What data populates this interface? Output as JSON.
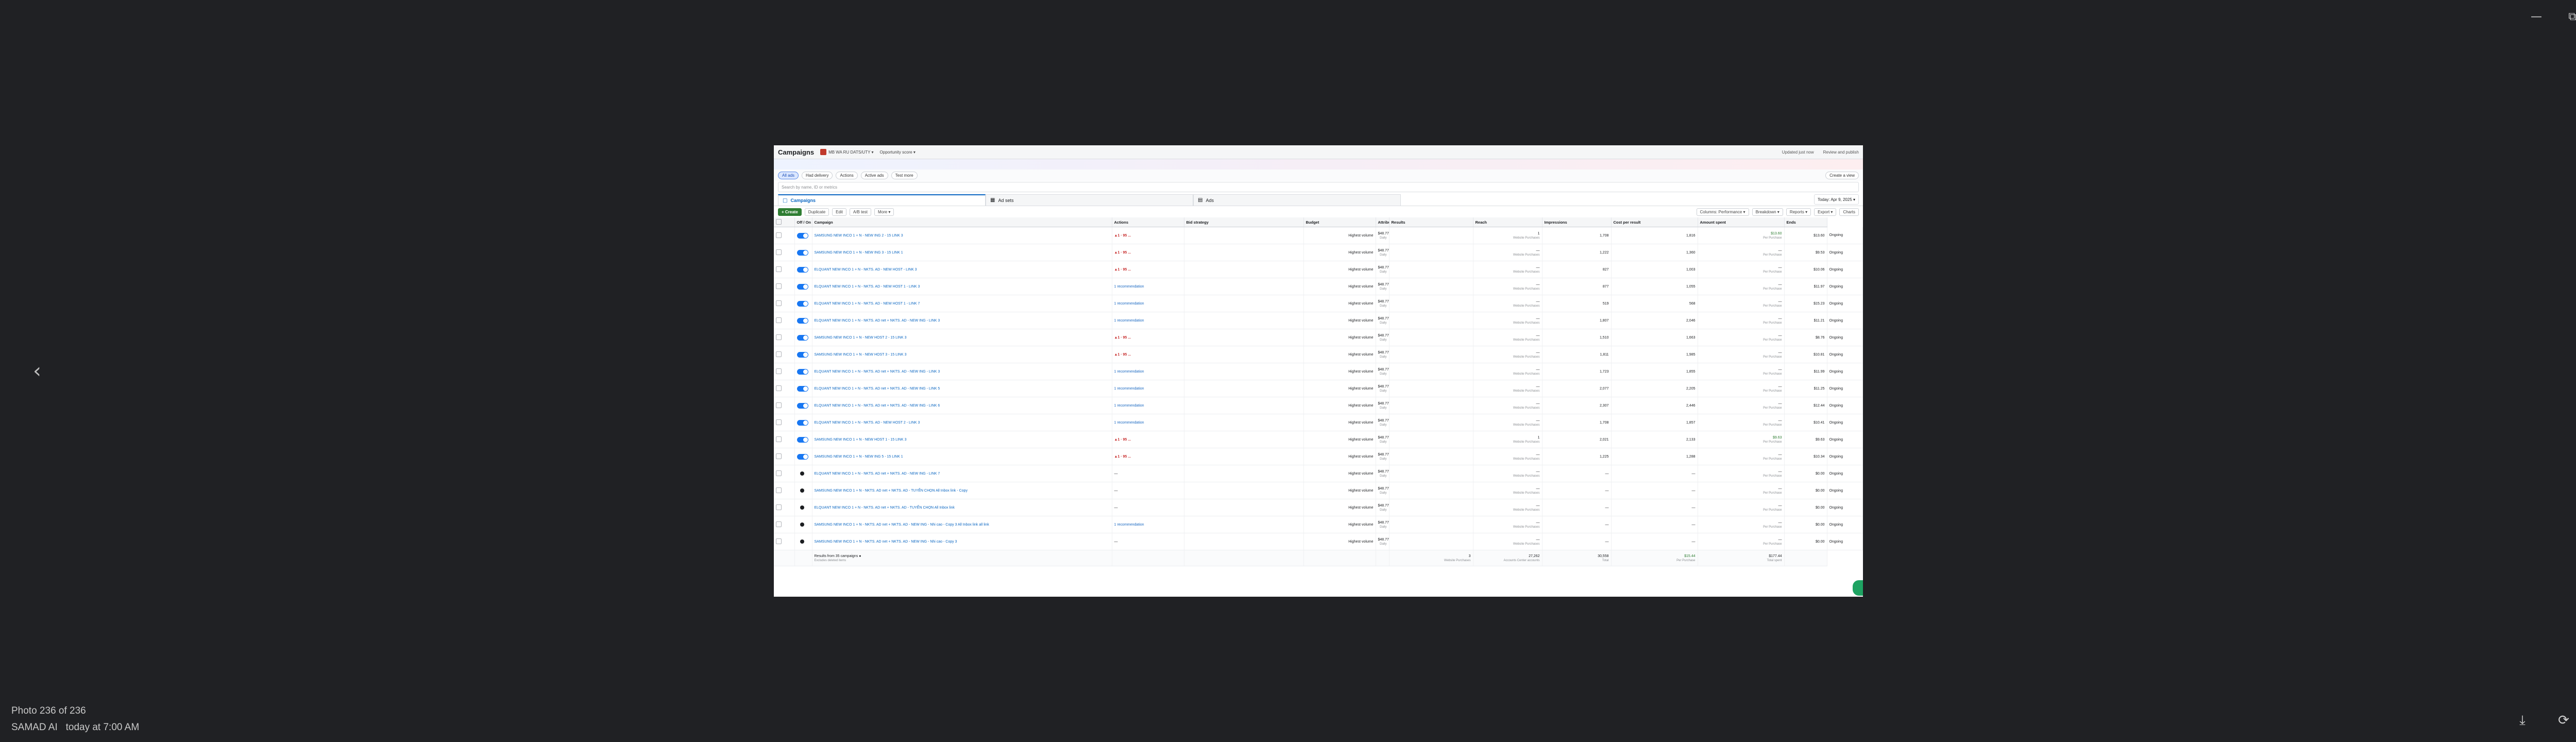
{
  "viewer": {
    "photo_count": "Photo 236 of 236",
    "author": "SAMAD AI",
    "time": "today at 7:00 AM",
    "icons": [
      "minimize-icon",
      "maximize-icon",
      "close-icon",
      "chevron-left-icon",
      "download-icon",
      "rotate-icon",
      "more-icon"
    ]
  },
  "header": {
    "title": "Campaigns",
    "account": "MB WA RU DATS/UTY ▾",
    "opportunity": "Opportunity score ▾",
    "updated": "Updated just now",
    "review": "Review and publish"
  },
  "filters": [
    "All ads",
    "Had delivery",
    "Actions",
    "Active ads",
    "Test more"
  ],
  "create_view": "Create a view",
  "search_placeholder": "Search by name, ID or metrics",
  "levels": [
    {
      "label": "Campaigns",
      "icon": "folder-icon",
      "active": true
    },
    {
      "label": "Ad sets",
      "icon": "grid-icon",
      "active": false
    },
    {
      "label": "Ads",
      "icon": "doc-icon",
      "active": false
    }
  ],
  "date_range": "Today: Apr 9, 2025 ▾",
  "toolbar": {
    "create": "+ Create",
    "duplicate": "Duplicate",
    "edit": "Edit",
    "ab_test": "A/B test",
    "more": "More ▾",
    "columns": "Columns: Performance ▾",
    "breakdown": "Breakdown ▾",
    "reports": "Reports ▾",
    "export": "Export ▾",
    "charts": "Charts"
  },
  "columns": [
    "Off / On",
    "Campaign",
    "Actions",
    "Bid strategy",
    "Budget",
    "Attribution setting",
    "Results",
    "Reach",
    "Impressions",
    "Cost per result",
    "Amount spent",
    "Ends"
  ],
  "rows": [
    {
      "on": true,
      "name": "SAMSUNG NEW INCO 1 + N - NEW ING 2 - 15 LINK 3",
      "action": "▲1 · 95 ...",
      "kind": "issue",
      "bid": "Highest volume",
      "budget": "$48.77 0847",
      "results": "1",
      "reach": "1,708",
      "impr": "1,816",
      "cpr": "$13.60",
      "spent": "$13.60",
      "ends": "Ongoing"
    },
    {
      "on": true,
      "name": "SAMSUNG NEW INCO 1 + N - NEW ING 3 - 15 LINK 1",
      "action": "▲1 · 95 ...",
      "kind": "issue",
      "bid": "Highest volume",
      "budget": "$48.77 0847",
      "results": "—",
      "reach": "1,222",
      "impr": "1,360",
      "cpr": "—",
      "spent": "$9.53",
      "ends": "Ongoing"
    },
    {
      "on": true,
      "name": "ELQUANT NEW INCO 1 + N - NKTS. AD - NEW HOST - LINK 3",
      "action": "▲1 · 95 ...",
      "kind": "issue",
      "bid": "Highest volume",
      "budget": "$48.77 0847",
      "results": "—",
      "reach": "827",
      "impr": "1,003",
      "cpr": "—",
      "spent": "$10.06",
      "ends": "Ongoing"
    },
    {
      "on": true,
      "name": "ELQUANT NEW INCO 1 + N - NKTS. AD - NEW HOST 1 - LINK 3",
      "action": "1 recommendation",
      "kind": "rec",
      "bid": "Highest volume",
      "budget": "$48.77 0847",
      "results": "—",
      "reach": "877",
      "impr": "1,055",
      "cpr": "—",
      "spent": "$11.97",
      "ends": "Ongoing"
    },
    {
      "on": true,
      "name": "ELQUANT NEW INCO 1 + N - NKTS. AD - NEW HOST 1 - LINK 7",
      "action": "1 recommendation",
      "kind": "rec",
      "bid": "Highest volume",
      "budget": "$48.77 0847",
      "results": "—",
      "reach": "519",
      "impr": "568",
      "cpr": "—",
      "spent": "$15.23",
      "ends": "Ongoing"
    },
    {
      "on": true,
      "name": "ELQUANT NEW INCO 1 + N - NKTS. AD net + NKTS. AD - NEW ING - LINK 3",
      "action": "1 recommendation",
      "kind": "rec",
      "bid": "Highest volume",
      "budget": "$48.77 0847",
      "results": "—",
      "reach": "1,807",
      "impr": "2,046",
      "cpr": "—",
      "spent": "$11.21",
      "ends": "Ongoing"
    },
    {
      "on": true,
      "name": "SAMSUNG NEW INCO 1 + N - NEW HOST 2 - 15 LINK 3",
      "action": "▲1 · 95 ...",
      "kind": "issue",
      "bid": "Highest volume",
      "budget": "$48.77 0847",
      "results": "—",
      "reach": "1,510",
      "impr": "1,663",
      "cpr": "—",
      "spent": "$8.76",
      "ends": "Ongoing"
    },
    {
      "on": true,
      "name": "SAMSUNG NEW INCO 1 + N - NEW HOST 3 - 15 LINK 3",
      "action": "▲1 · 95 ...",
      "kind": "issue",
      "bid": "Highest volume",
      "budget": "$48.77 0847",
      "results": "—",
      "reach": "1,811",
      "impr": "1,985",
      "cpr": "—",
      "spent": "$10.81",
      "ends": "Ongoing"
    },
    {
      "on": true,
      "name": "ELQUANT NEW INCO 1 + N - NKTS. AD net + NKTS. AD - NEW ING - LINK 3",
      "action": "1 recommendation",
      "kind": "rec",
      "bid": "Highest volume",
      "budget": "$48.77 0847",
      "results": "—",
      "reach": "1,723",
      "impr": "1,855",
      "cpr": "—",
      "spent": "$11.99",
      "ends": "Ongoing"
    },
    {
      "on": true,
      "name": "ELQUANT NEW INCO 1 + N - NKTS. AD net + NKTS. AD - NEW ING - LINK 5",
      "action": "1 recommendation",
      "kind": "rec",
      "bid": "Highest volume",
      "budget": "$48.77 0847",
      "results": "—",
      "reach": "2,077",
      "impr": "2,205",
      "cpr": "—",
      "spent": "$11.25",
      "ends": "Ongoing"
    },
    {
      "on": true,
      "name": "ELQUANT NEW INCO 1 + N - NKTS. AD net + NKTS. AD - NEW ING - LINK 6",
      "action": "1 recommendation",
      "kind": "rec",
      "bid": "Highest volume",
      "budget": "$48.77 0847",
      "results": "—",
      "reach": "2,307",
      "impr": "2,446",
      "cpr": "—",
      "spent": "$12.44",
      "ends": "Ongoing"
    },
    {
      "on": true,
      "name": "ELQUANT NEW INCO 1 + N - NKTS. AD - NEW HOST 2 - LINK 3",
      "action": "1 recommendation",
      "kind": "rec",
      "bid": "Highest volume",
      "budget": "$48.77 0847",
      "results": "—",
      "reach": "1,708",
      "impr": "1,857",
      "cpr": "—",
      "spent": "$10.41",
      "ends": "Ongoing"
    },
    {
      "on": true,
      "name": "SAMSUNG NEW INCO 1 + N - NEW HOST 1 - 15 LINK 3",
      "action": "▲1 · 95 ...",
      "kind": "issue",
      "bid": "Highest volume",
      "budget": "$48.77 0847",
      "results": "1",
      "reach": "2,021",
      "impr": "2,133",
      "cpr": "$9.63",
      "spent": "$9.63",
      "ends": "Ongoing"
    },
    {
      "on": true,
      "name": "SAMSUNG NEW INCO 1 + N - NEW ING 5 - 15 LINK 1",
      "action": "▲1 · 95 ...",
      "kind": "issue",
      "bid": "Highest volume",
      "budget": "$48.77 0847",
      "results": "—",
      "reach": "1,225",
      "impr": "1,288",
      "cpr": "—",
      "spent": "$10.34",
      "ends": "Ongoing"
    },
    {
      "on": false,
      "name": "ELQUANT NEW INCO 1 + N - NKTS. AD net + NKTS. AD - NEW ING - LINK 7",
      "action": "—",
      "kind": "none",
      "bid": "Highest volume",
      "budget": "$48.77 0847",
      "results": "—",
      "reach": "—",
      "impr": "—",
      "cpr": "—",
      "spent": "$0.00",
      "ends": "Ongoing"
    },
    {
      "on": false,
      "name": "SAMSUNG NEW INCO 1 + N - NKTS. AD net + NKTS. AD - TUYỂN CHỌN All Inbox link - Copy",
      "action": "—",
      "kind": "none",
      "bid": "Highest volume",
      "budget": "$48.77 0847",
      "results": "—",
      "reach": "—",
      "impr": "—",
      "cpr": "—",
      "spent": "$0.00",
      "ends": "Ongoing"
    },
    {
      "on": false,
      "name": "ELQUANT NEW INCO 1 + N - NKTS. AD net + NKTS. AD - TUYỂN CHỌN All Inbox link",
      "action": "—",
      "kind": "none",
      "bid": "Highest volume",
      "budget": "$48.77 0847",
      "results": "—",
      "reach": "—",
      "impr": "—",
      "cpr": "—",
      "spent": "$0.00",
      "ends": "Ongoing"
    },
    {
      "on": false,
      "name": "SAMSUNG NEW INCO 1 + N - NKTS. AD net + NKTS. AD - NEW ING - Nhi cao - Copy 3 All Inbox link all link",
      "action": "1 recommendation",
      "kind": "rec",
      "bid": "Highest volume",
      "budget": "$48.77 0847",
      "results": "—",
      "reach": "—",
      "impr": "—",
      "cpr": "—",
      "spent": "$0.00",
      "ends": "Ongoing"
    },
    {
      "on": false,
      "name": "SAMSUNG NEW INCO 1 + N - NKTS. AD net + NKTS. AD - NEW ING - Nhi cao - Copy 3",
      "action": "—",
      "kind": "none",
      "bid": "Highest volume",
      "budget": "$48.77 0847",
      "results": "—",
      "reach": "—",
      "impr": "—",
      "cpr": "—",
      "spent": "$0.00",
      "ends": "Ongoing"
    }
  ],
  "result_sub": "Website Purchases",
  "cpr_sub": "Per Purchase",
  "budget_sub": "Daily",
  "totals": {
    "label": "Results from 35 campaigns",
    "sub": "Excludes deleted items",
    "results": "3",
    "reach": "27,262",
    "reach_sub": "Accounts Center accounts",
    "impr": "30,558",
    "impr_sub": "Total",
    "cpr": "$15.44",
    "cpr_sub": "Per Purchase",
    "spent": "$177.44",
    "spent_sub": "Total spent"
  }
}
